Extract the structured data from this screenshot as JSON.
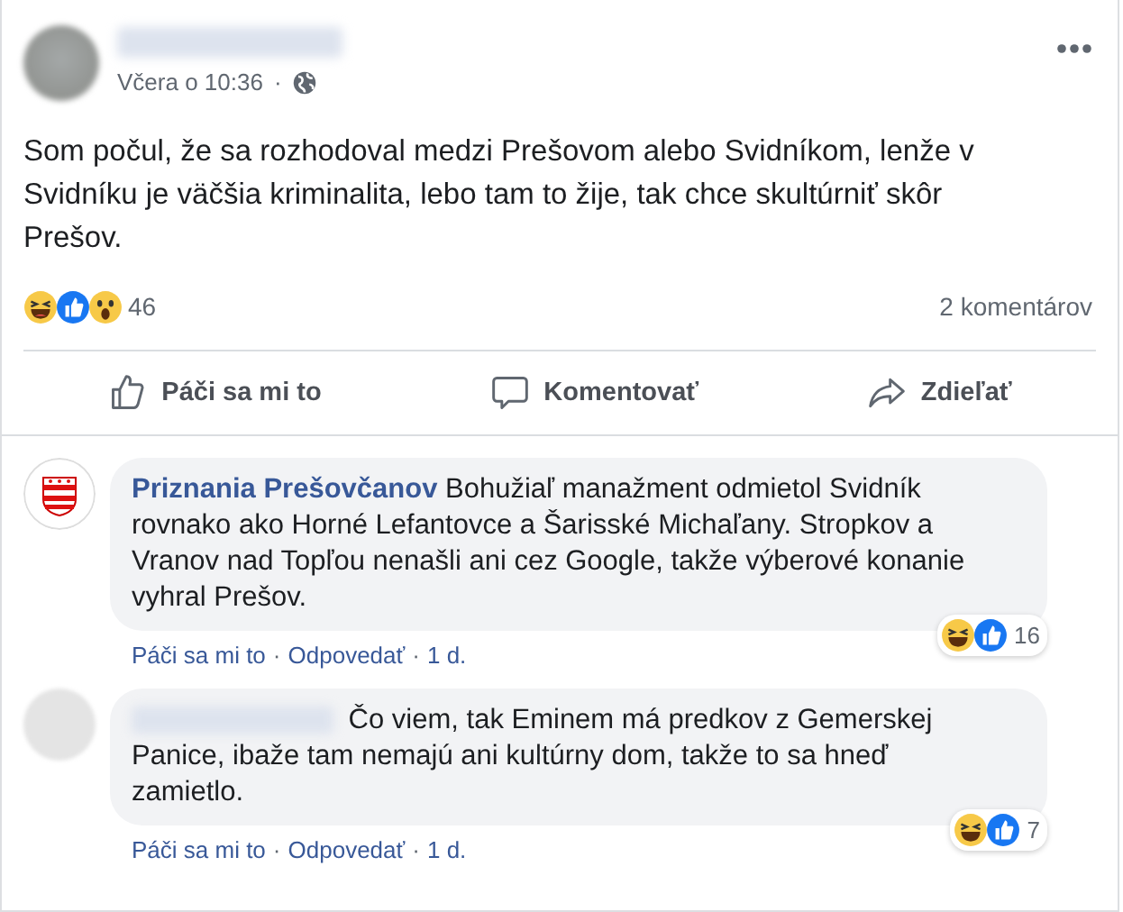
{
  "post": {
    "time": "Včera o 10:36",
    "separator": "·",
    "text": "Som počul, že sa rozhodoval medzi Prešovom alebo Svidníkom, lenže v Svidníku je väčšia kriminalita, lebo tam to žije, tak chce skultúrniť skôr Prešov.",
    "reactions": [
      {
        "kind": "haha"
      },
      {
        "kind": "like"
      },
      {
        "kind": "wow"
      }
    ],
    "reaction_count": "46",
    "comment_count": "2 komentárov"
  },
  "actions": [
    {
      "kind": "like",
      "label": "Páči sa mi to"
    },
    {
      "kind": "comment",
      "label": "Komentovať"
    },
    {
      "kind": "share",
      "label": "Zdieľať"
    }
  ],
  "comments": [
    {
      "kind": "page",
      "author": "Priznania Prešovčanov",
      "text": "Bohužiaľ manažment odmietol Svidník rovnako ako Horné Lefantovce a Šarisské Michaľany. Stropkov a Vranov nad Topľou nenašli ani cez Google, takže výberové konanie vyhral Prešov.",
      "reactions": [
        {
          "kind": "haha"
        },
        {
          "kind": "like"
        }
      ],
      "reaction_count": "16",
      "like": "Páči sa mi to",
      "separator": "·",
      "reply": "Odpovedať",
      "time": "1 d."
    },
    {
      "kind": "hidden",
      "text": "Čo viem, tak Eminem má predkov z Gemerskej Panice, ibaže tam nemajú ani kultúrny dom, takže to sa hneď zamietlo.",
      "reactions": [
        {
          "kind": "haha"
        },
        {
          "kind": "like"
        }
      ],
      "reaction_count": "7",
      "like": "Páči sa mi to",
      "separator": "·",
      "reply": "Odpovedať",
      "time": "1 d."
    }
  ]
}
